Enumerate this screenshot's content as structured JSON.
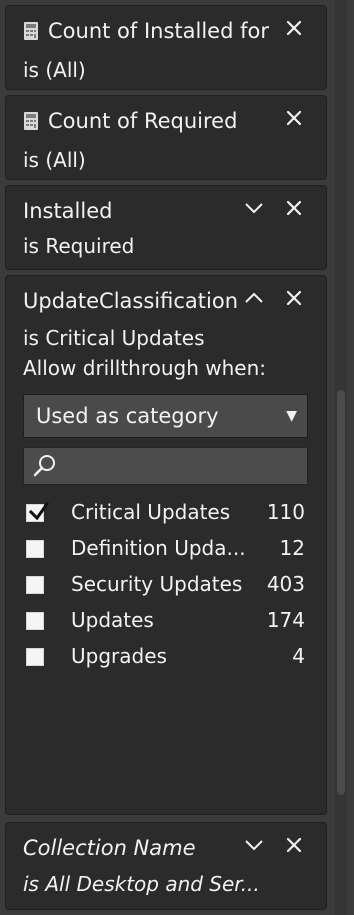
{
  "filters": [
    {
      "title": "Count of Installed for",
      "subtitle": "is (All)",
      "icon": "calculator-icon"
    },
    {
      "title": "Count of Required",
      "subtitle": "is (All)",
      "icon": "calculator-icon"
    },
    {
      "title": "Installed",
      "subtitle": "is Required"
    },
    {
      "title": "UpdateClassification",
      "subtitle": "is Critical Updates",
      "drillthrough_label": "Allow drillthrough when:",
      "dropdown_value": "Used as category",
      "search_placeholder": "",
      "items": [
        {
          "label": "Critical Updates",
          "count": "110",
          "checked": true
        },
        {
          "label": "Definition Upda...",
          "count": "12",
          "checked": false
        },
        {
          "label": "Security Updates",
          "count": "403",
          "checked": false
        },
        {
          "label": "Updates",
          "count": "174",
          "checked": false
        },
        {
          "label": "Upgrades",
          "count": "4",
          "checked": false
        }
      ]
    },
    {
      "title": "Collection Name",
      "subtitle": "is All Desktop and Ser..."
    }
  ],
  "icons": {
    "close": "close-icon",
    "collapse": "chevron-up-icon",
    "expand": "chevron-down-icon",
    "search": "search-icon",
    "dropdown": "caret-down-icon",
    "check": "checkmark-icon",
    "calculator": "calculator-icon"
  },
  "colors": {
    "pane_background": "#3b3b3b",
    "card_background": "#2b2b2b",
    "text": "#f2f2f2",
    "field_background": "#4a4a4a"
  }
}
